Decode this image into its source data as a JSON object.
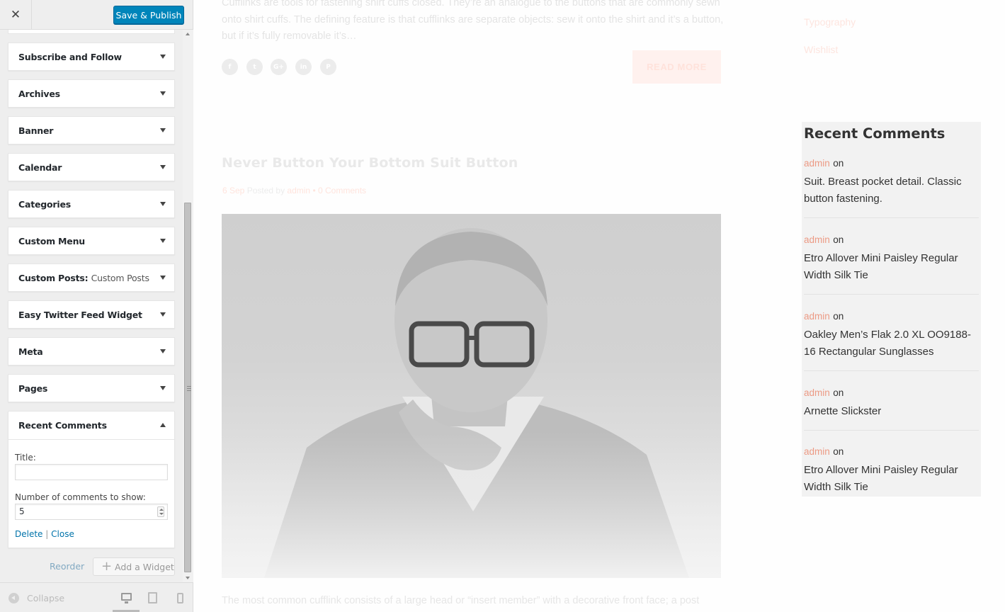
{
  "sidebar": {
    "close_glyph": "✕",
    "save_publish": "Save & Publish",
    "widgets": [
      {
        "title": "Subscribe and Follow"
      },
      {
        "title": "Archives"
      },
      {
        "title": "Banner"
      },
      {
        "title": "Calendar"
      },
      {
        "title": "Categories"
      },
      {
        "title": "Custom Menu"
      },
      {
        "title": "Custom Posts:",
        "subtitle": "Custom Posts"
      },
      {
        "title": "Easy Twitter Feed Widget"
      },
      {
        "title": "Meta"
      },
      {
        "title": "Pages"
      }
    ],
    "recent_comments_widget": {
      "title": "Recent Comments",
      "title_label": "Title:",
      "title_value": "",
      "number_label": "Number of comments to show:",
      "number_value": "5",
      "delete": "Delete",
      "separator": "|",
      "close": "Close"
    },
    "reorder": "Reorder",
    "add_widget_plus": "+",
    "add_widget": "Add a Widget",
    "collapse": "Collapse",
    "active_device": "desktop"
  },
  "preview": {
    "excerpt": "Cufflinks are tools for fastening shirt cuffs closed. They’re an analogue to the buttons that are commonly sewn onto shirt cuffs. The defining feature is that cufflinks are separate objects: sew it onto the shirt and it’s a button, but if it’s fully removable it’s…",
    "social_icons": [
      {
        "name": "facebook-icon",
        "glyph": "f"
      },
      {
        "name": "twitter-icon",
        "glyph": "t"
      },
      {
        "name": "google-plus-icon",
        "glyph": "G+"
      },
      {
        "name": "linkedin-icon",
        "glyph": "in"
      },
      {
        "name": "pinterest-icon",
        "glyph": "P"
      }
    ],
    "read_more": "READ MORE",
    "post_title": "Never Button Your Bottom Suit Button",
    "post_date": "6 Sep",
    "posted_by": "Posted by",
    "post_author": "admin",
    "meta_dot": "•",
    "post_comments": "0 Comments",
    "bottom_text": "The most common cufflink consists of a large head or “insert member” with a decorative front face; a post",
    "menu_items": [
      "Typography",
      "Wishlist"
    ],
    "recent_comments": {
      "title": "Recent Comments",
      "on_word": "on",
      "items": [
        {
          "author": "admin",
          "post": "Suit. Breast pocket detail. Classic button fastening."
        },
        {
          "author": "admin",
          "post": "Etro Allover Mini Paisley Regular Width Silk Tie"
        },
        {
          "author": "admin",
          "post": "Oakley Men’s Flak 2.0 XL OO9188-16 Rectangular Sunglasses"
        },
        {
          "author": "admin",
          "post": "Arnette Slickster"
        },
        {
          "author": "admin",
          "post": "Etro Allover Mini Paisley Regular Width Silk Tie"
        }
      ]
    }
  },
  "colors": {
    "primary_button": "#0085ba",
    "link": "#0073aa",
    "accent": "#ec9a84"
  }
}
